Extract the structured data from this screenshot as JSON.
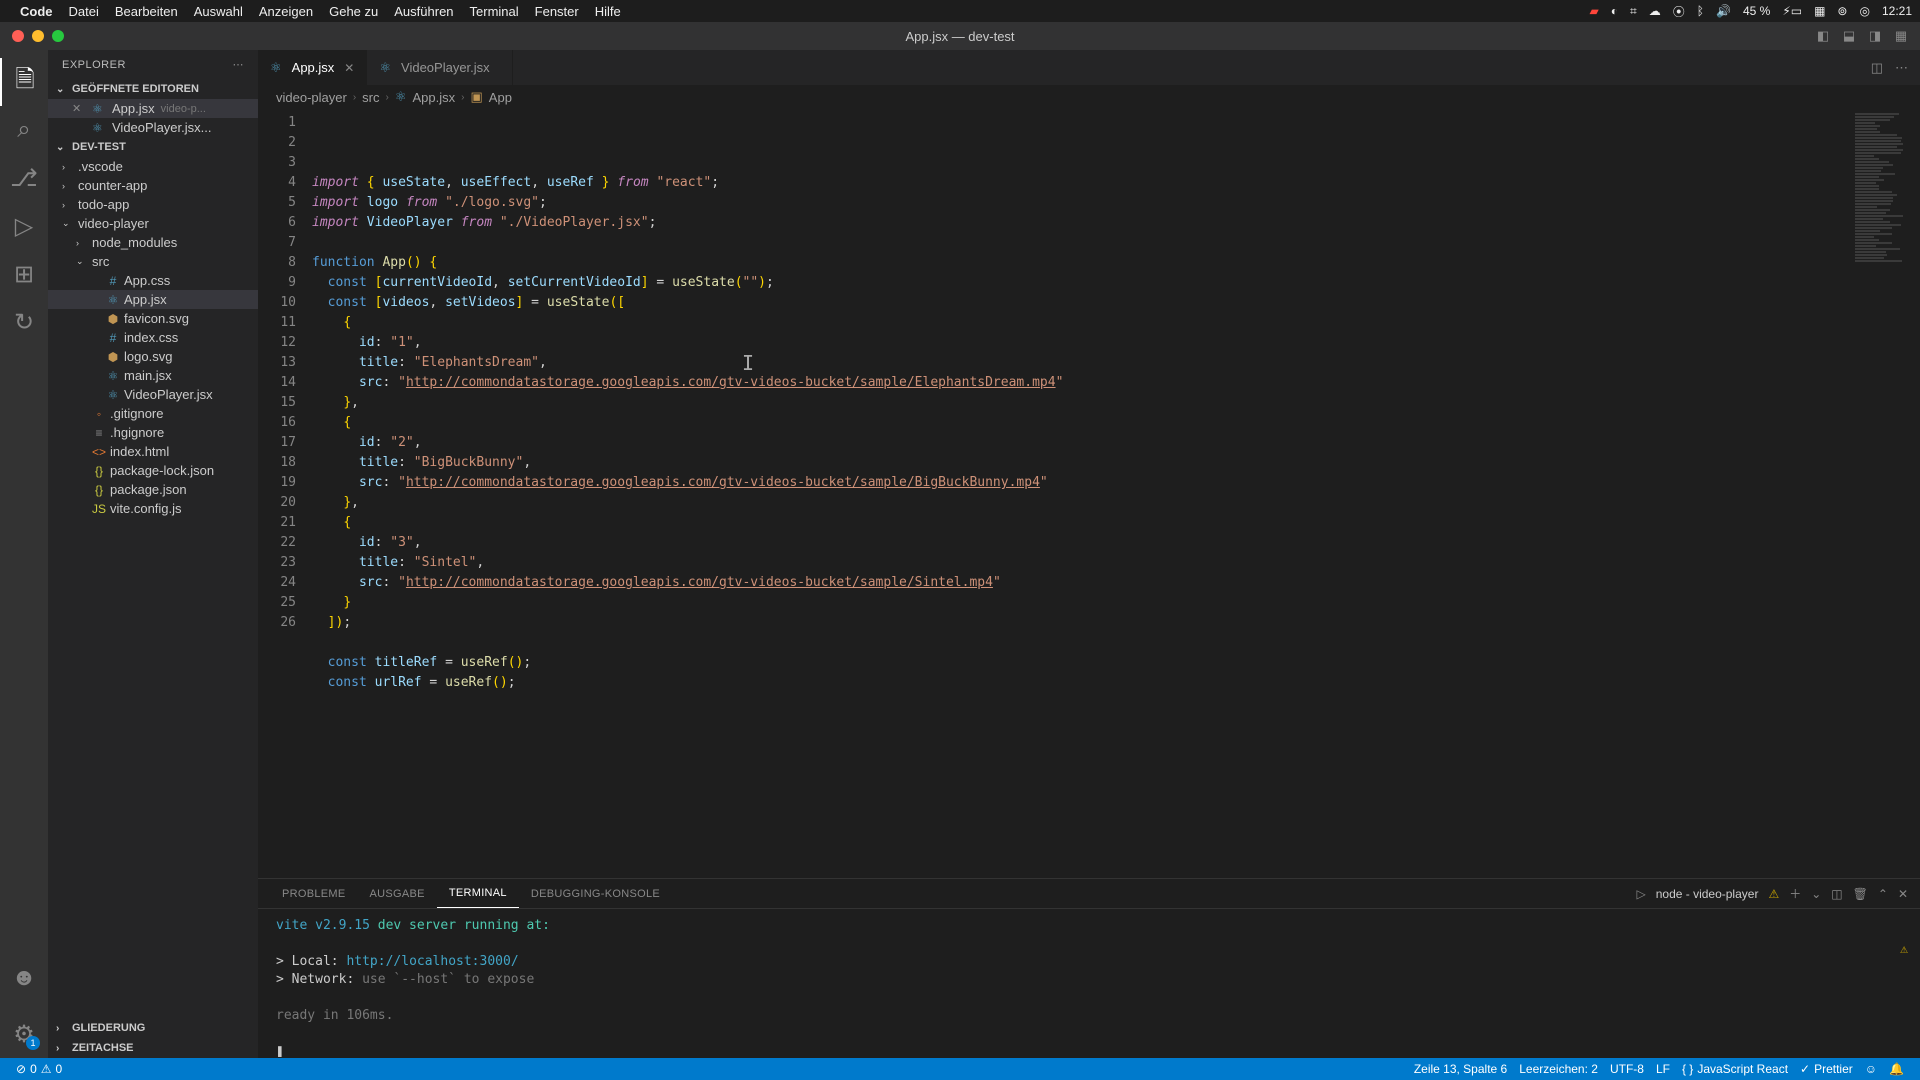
{
  "menubar": {
    "app": "Code",
    "items": [
      "Datei",
      "Bearbeiten",
      "Auswahl",
      "Anzeigen",
      "Gehe zu",
      "Ausführen",
      "Terminal",
      "Fenster",
      "Hilfe"
    ],
    "battery": "45 %",
    "time": "12:21"
  },
  "window": {
    "title": "App.jsx — dev-test"
  },
  "explorer": {
    "title": "EXPLORER",
    "open_editors_label": "GEÖFFNETE EDITOREN",
    "open_editors": [
      {
        "name": "App.jsx",
        "dir": "video-p...",
        "active": true,
        "icon": "⚛︎",
        "icon_class": "ico-react"
      },
      {
        "name": "VideoPlayer.jsx...",
        "dir": "",
        "active": false,
        "icon": "⚛︎",
        "icon_class": "ico-react"
      }
    ],
    "workspace_label": "DEV-TEST",
    "tree": [
      {
        "name": ".vscode",
        "depth": 0,
        "chev": "›",
        "icon": ""
      },
      {
        "name": "counter-app",
        "depth": 0,
        "chev": "›",
        "icon": ""
      },
      {
        "name": "todo-app",
        "depth": 0,
        "chev": "›",
        "icon": ""
      },
      {
        "name": "video-player",
        "depth": 0,
        "chev": "⌄",
        "icon": ""
      },
      {
        "name": "node_modules",
        "depth": 1,
        "chev": "›",
        "icon": ""
      },
      {
        "name": "src",
        "depth": 1,
        "chev": "⌄",
        "icon": ""
      },
      {
        "name": "App.css",
        "depth": 2,
        "chev": "",
        "icon": "#",
        "icon_class": "ico-css"
      },
      {
        "name": "App.jsx",
        "depth": 2,
        "chev": "",
        "icon": "⚛︎",
        "icon_class": "ico-react",
        "active": true
      },
      {
        "name": "favicon.svg",
        "depth": 2,
        "chev": "",
        "icon": "⬢",
        "icon_class": "ico-svg"
      },
      {
        "name": "index.css",
        "depth": 2,
        "chev": "",
        "icon": "#",
        "icon_class": "ico-css"
      },
      {
        "name": "logo.svg",
        "depth": 2,
        "chev": "",
        "icon": "⬢",
        "icon_class": "ico-svg"
      },
      {
        "name": "main.jsx",
        "depth": 2,
        "chev": "",
        "icon": "⚛︎",
        "icon_class": "ico-react"
      },
      {
        "name": "VideoPlayer.jsx",
        "depth": 2,
        "chev": "",
        "icon": "⚛︎",
        "icon_class": "ico-react"
      },
      {
        "name": ".gitignore",
        "depth": 1,
        "chev": "",
        "icon": "◦",
        "icon_class": "ico-git"
      },
      {
        "name": ".hgignore",
        "depth": 1,
        "chev": "",
        "icon": "≡",
        "icon_class": "ico-generic"
      },
      {
        "name": "index.html",
        "depth": 1,
        "chev": "",
        "icon": "<>",
        "icon_class": "ico-html"
      },
      {
        "name": "package-lock.json",
        "depth": 1,
        "chev": "",
        "icon": "{}",
        "icon_class": "ico-json"
      },
      {
        "name": "package.json",
        "depth": 1,
        "chev": "",
        "icon": "{}",
        "icon_class": "ico-json"
      },
      {
        "name": "vite.config.js",
        "depth": 1,
        "chev": "",
        "icon": "JS",
        "icon_class": "ico-js"
      }
    ],
    "outline_label": "GLIEDERUNG",
    "timeline_label": "ZEITACHSE"
  },
  "settings_badge": "1",
  "tabs": [
    {
      "name": "App.jsx",
      "icon": "⚛︎",
      "active": true
    },
    {
      "name": "VideoPlayer.jsx",
      "icon": "⚛︎",
      "active": false
    }
  ],
  "breadcrumbs": [
    "video-player",
    "src",
    "App.jsx",
    "App"
  ],
  "code_lines": [
    "<span class='c-keyword'>import</span> <span class='c-brace'>{</span> <span class='c-var'>useState</span>, <span class='c-var'>useEffect</span>, <span class='c-var'>useRef</span> <span class='c-brace'>}</span> <span class='c-keyword'>from</span> <span class='c-string'>\"react\"</span>;",
    "<span class='c-keyword'>import</span> <span class='c-var'>logo</span> <span class='c-keyword'>from</span> <span class='c-string'>\"./logo.svg\"</span>;",
    "<span class='c-keyword'>import</span> <span class='c-var'>VideoPlayer</span> <span class='c-keyword'>from</span> <span class='c-string'>\"./VideoPlayer.jsx\"</span>;",
    "",
    "<span class='c-const'>function</span> <span class='c-func'>App</span><span class='c-brace'>()</span> <span class='c-brace'>{</span>",
    "  <span class='c-const'>const</span> <span class='c-brace'>[</span><span class='c-var'>currentVideoId</span>, <span class='c-var'>setCurrentVideoId</span><span class='c-brace'>]</span> = <span class='c-func'>useState</span><span class='c-brace'>(</span><span class='c-string'>\"\"</span><span class='c-brace'>)</span>;",
    "  <span class='c-const'>const</span> <span class='c-brace'>[</span><span class='c-var'>videos</span>, <span class='c-var'>setVideos</span><span class='c-brace'>]</span> = <span class='c-func'>useState</span><span class='c-brace'>([</span>",
    "    <span class='c-brace'>{</span>",
    "      <span class='c-var'>id</span>: <span class='c-string'>\"1\"</span>,",
    "      <span class='c-var'>title</span>: <span class='c-string'>\"ElephantsDream\"</span>,",
    "      <span class='c-var'>src</span>: <span class='c-string'>\"</span><span class='c-url'>http://commondatastorage.googleapis.com/gtv-videos-bucket/sample/ElephantsDream.mp4</span><span class='c-string'>\"</span>",
    "    <span class='c-brace'>}</span>,",
    "    <span class='c-brace'>{</span>",
    "      <span class='c-var'>id</span>: <span class='c-string'>\"2\"</span>,",
    "      <span class='c-var'>title</span>: <span class='c-string'>\"BigBuckBunny\"</span>,",
    "      <span class='c-var'>src</span>: <span class='c-string'>\"</span><span class='c-url'>http://commondatastorage.googleapis.com/gtv-videos-bucket/sample/BigBuckBunny.mp4</span><span class='c-string'>\"</span>",
    "    <span class='c-brace'>}</span>,",
    "    <span class='c-brace'>{</span>",
    "      <span class='c-var'>id</span>: <span class='c-string'>\"3\"</span>,",
    "      <span class='c-var'>title</span>: <span class='c-string'>\"Sintel\"</span>,",
    "      <span class='c-var'>src</span>: <span class='c-string'>\"</span><span class='c-url'>http://commondatastorage.googleapis.com/gtv-videos-bucket/sample/Sintel.mp4</span><span class='c-string'>\"</span>",
    "    <span class='c-brace'>}</span>",
    "  <span class='c-brace'>])</span>;",
    "",
    "  <span class='c-const'>const</span> <span class='c-var'>titleRef</span> = <span class='c-func'>useRef</span><span class='c-brace'>()</span>;",
    "  <span class='c-const'>const</span> <span class='c-var'>urlRef</span> = <span class='c-func'>useRef</span><span class='c-brace'>()</span>;"
  ],
  "panel": {
    "tabs": [
      "PROBLEME",
      "AUSGABE",
      "TERMINAL",
      "DEBUGGING-KONSOLE"
    ],
    "active_tab": "TERMINAL",
    "terminal_label": "node - video-player",
    "lines": [
      {
        "text": "  <span class='t-cyan'>vite v2.9.15</span> <span class='t-green'>dev server running at:</span>"
      },
      {
        "text": ""
      },
      {
        "text": "  > Local: <span class='t-cyan'>http://localhost:</span><span class='t-cyan'>3000</span><span class='t-cyan'>/</span>"
      },
      {
        "text": "  > Network: <span class='t-dim'>use `--host` to expose</span>"
      },
      {
        "text": ""
      },
      {
        "text": "  <span class='t-dim'>ready in 106ms.</span>"
      },
      {
        "text": ""
      },
      {
        "text": "❚"
      }
    ]
  },
  "statusbar": {
    "errors": "0",
    "warnings": "0",
    "line_col": "Zeile 13, Spalte 6",
    "spaces": "Leerzeichen: 2",
    "encoding": "UTF-8",
    "eol": "LF",
    "lang": "JavaScript React",
    "prettier": "Prettier"
  }
}
